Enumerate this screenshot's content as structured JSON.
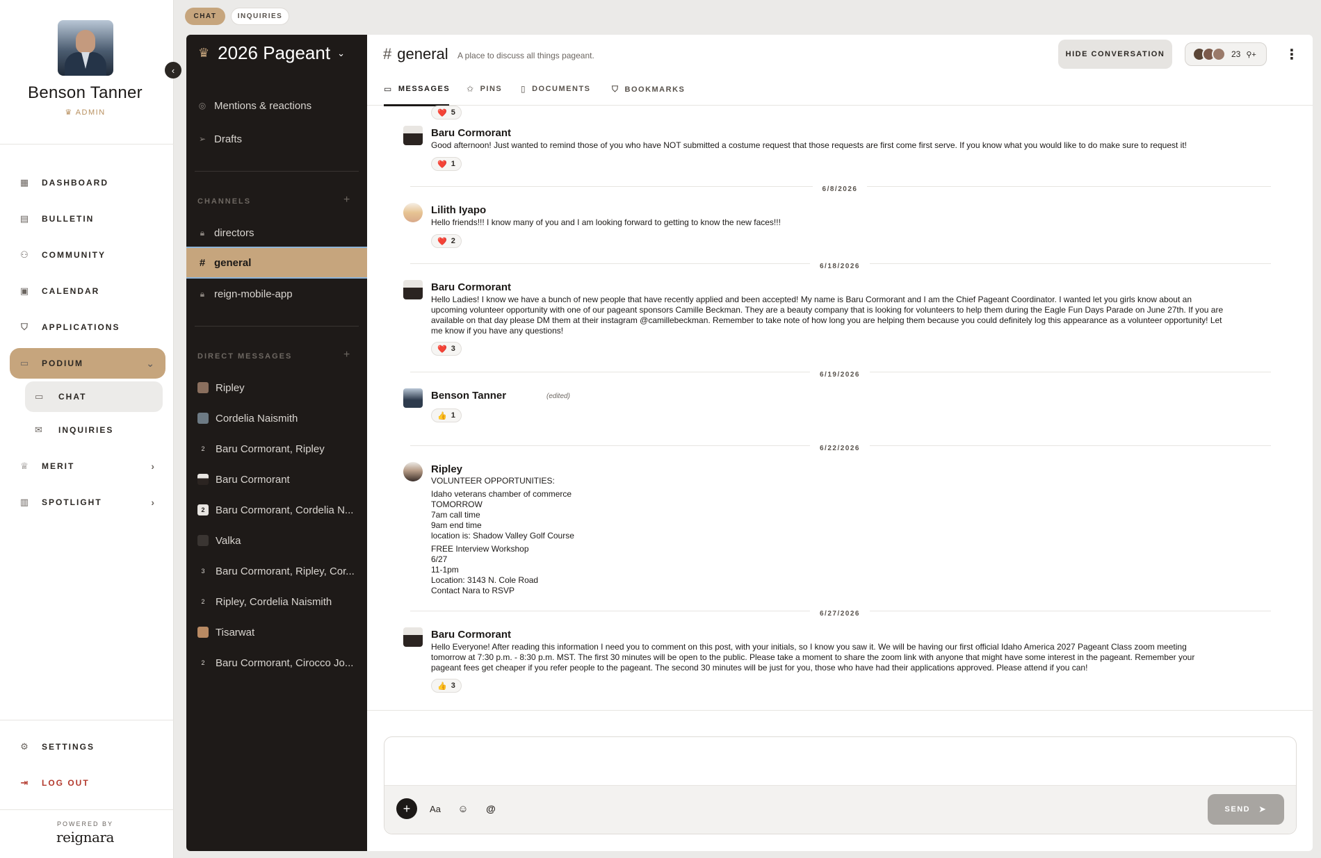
{
  "top_tabs": {
    "chat": "CHAT",
    "inquiries": "INQUIRIES"
  },
  "user": {
    "name": "Benson Tanner",
    "role": "ADMIN"
  },
  "nav": {
    "dashboard": "DASHBOARD",
    "bulletin": "BULLETIN",
    "community": "COMMUNITY",
    "calendar": "CALENDAR",
    "applications": "APPLICATIONS",
    "podium": "PODIUM",
    "chat": "CHAT",
    "inquiries": "INQUIRIES",
    "merit": "MERIT",
    "spotlight": "SPOTLIGHT",
    "settings": "SETTINGS",
    "logout": "LOG OUT"
  },
  "footer": {
    "powered_by": "POWERED BY",
    "brand": "reignara"
  },
  "workspace": {
    "title": "2026 Pageant"
  },
  "sidebar": {
    "mentions": "Mentions & reactions",
    "drafts": "Drafts",
    "channels_header": "CHANNELS",
    "channels": [
      "directors",
      "general",
      "reign-mobile-app"
    ],
    "dm_header": "DIRECT MESSAGES",
    "dms": [
      {
        "badge": "",
        "name": "Ripley"
      },
      {
        "badge": "",
        "name": "Cordelia Naismith"
      },
      {
        "badge": "2",
        "name": "Baru Cormorant, Ripley"
      },
      {
        "badge": "",
        "name": "Baru Cormorant"
      },
      {
        "badge": "2",
        "name": "Baru Cormorant, Cordelia N..."
      },
      {
        "badge": "",
        "name": "Valka"
      },
      {
        "badge": "3",
        "name": "Baru Cormorant, Ripley, Cor..."
      },
      {
        "badge": "2",
        "name": "Ripley, Cordelia Naismith"
      },
      {
        "badge": "",
        "name": "Tisarwat"
      },
      {
        "badge": "2",
        "name": "Baru Cormorant, Cirocco Jo..."
      }
    ]
  },
  "channel": {
    "hash": "#",
    "name": "general",
    "description": "A place to discuss all things pageant.",
    "hide_label": "HIDE CONVERSATION",
    "member_count": "23"
  },
  "tabs": {
    "messages": "MESSAGES",
    "pins": "PINS",
    "documents": "DOCUMENTS",
    "bookmarks": "BOOKMARKS"
  },
  "messages": {
    "r0": {
      "emoji": "❤️",
      "count": "5"
    },
    "m1": {
      "author": "Baru Cormorant",
      "text": "Good afternoon! Just wanted to remind those of you who have NOT submitted a costume request that those requests are first come first serve. If you know what you would like to do make sure to request it!",
      "emoji": "❤️",
      "count": "1"
    },
    "d1": "6/8/2026",
    "m2": {
      "author": "Lilith Iyapo",
      "text": "Hello friends!!! I know many of you and I am looking forward to getting to know the new faces!!!",
      "emoji": "❤️",
      "count": "2"
    },
    "d2": "6/18/2026",
    "m3": {
      "author": "Baru Cormorant",
      "lines": [
        "Hello Ladies! I know we have a bunch of new people that have recently applied and been accepted! My name is Baru Cormorant and I am the Chief Pageant Coordinator. I wanted let you girls know about an",
        "upcoming volunteer opportunity with one of our pageant sponsors Camille Beckman. They are a beauty company that is looking for volunteers to help them during the Eagle Fun Days Parade on June 27th. If you are",
        "available on that day please DM them at their instagram @camillebeckman. Remember to take note of how long you are helping them because you could definitely log this appearance as a volunteer opportunity! Let",
        "me know if you have any questions!"
      ],
      "emoji": "❤️",
      "count": "3"
    },
    "d3": "6/19/2026",
    "m4": {
      "author": "Benson Tanner",
      "edited": "(edited)",
      "emoji": "👍",
      "count": "1"
    },
    "d4": "6/22/2026",
    "m5": {
      "author": "Ripley",
      "lines1": [
        "VOLUNTEER OPPORTUNITIES:"
      ],
      "lines2": [
        "Idaho veterans chamber of commerce",
        "TOMORROW",
        "7am call time",
        "9am end time",
        "location is: Shadow Valley Golf Course"
      ],
      "lines3": [
        "FREE Interview Workshop",
        "6/27",
        "11-1pm",
        "Location: 3143 N. Cole Road",
        "Contact Nara to RSVP"
      ]
    },
    "d5": "6/27/2026",
    "m6": {
      "author": "Baru Cormorant",
      "lines": [
        "Hello Everyone! After reading this information I need you to comment on this post, with your initials, so I know you saw it. We will be having our first official Idaho America 2027 Pageant Class zoom meeting",
        "tomorrow at 7:30 p.m. - 8:30 p.m. MST. The first 30 minutes will be open to the public. Please take a moment to share the zoom link with anyone that might have some interest in the pageant. Remember your",
        "pageant fees get cheaper if you refer people to the pageant. The second 30 minutes will be just for you, those who have had their applications approved. Please attend if you can!"
      ],
      "emoji": "👍",
      "count": "3"
    }
  },
  "composer": {
    "format": "Aa",
    "mention": "@",
    "send": "SEND"
  }
}
